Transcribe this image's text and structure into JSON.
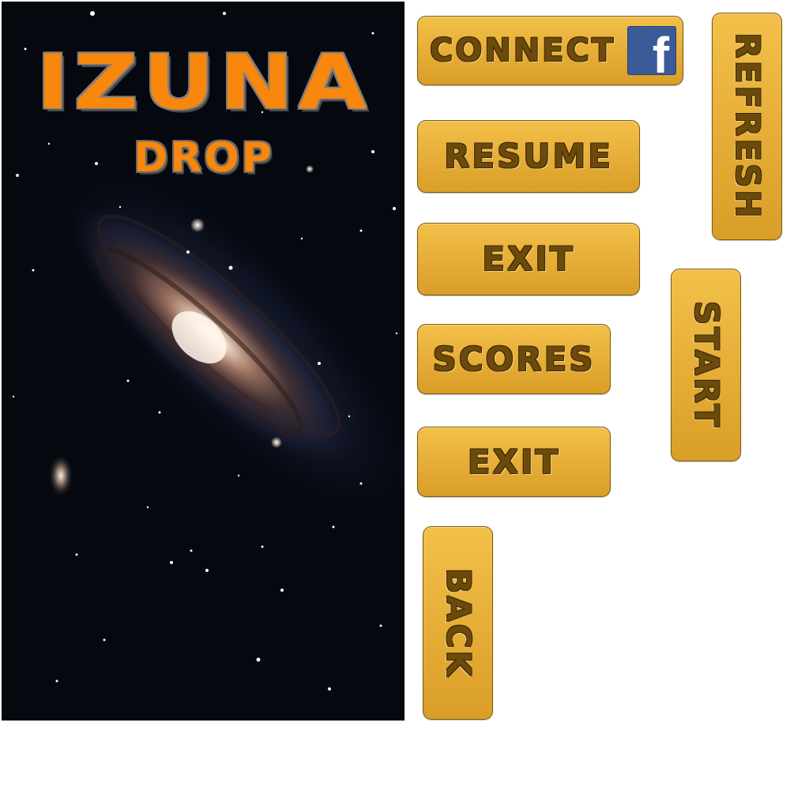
{
  "splash": {
    "title": "IZUNA",
    "subtitle": "DROP"
  },
  "buttons": {
    "connect": "CONNECT",
    "resume": "RESUME",
    "exit_primary": "EXIT",
    "scores": "SCORES",
    "exit_secondary": "EXIT",
    "refresh": "REFRESH",
    "start": "START",
    "back": "BACK"
  },
  "icons": {
    "facebook": "facebook-icon",
    "facebook_glyph": "f"
  },
  "colors": {
    "logo_orange": "#f7870d",
    "button_gold": "#e8b03a",
    "button_text": "#6b4a0c",
    "facebook_blue": "#3b5a98",
    "space_background": "#05080f"
  }
}
